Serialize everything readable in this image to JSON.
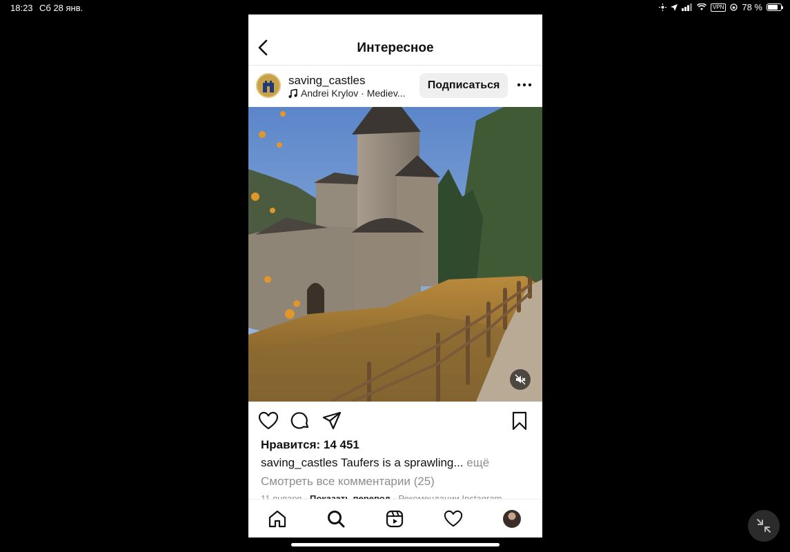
{
  "status_bar": {
    "time": "18:23",
    "date": "Сб 28 янв.",
    "vpn": "VPN",
    "battery": "78 %",
    "battery_level": 0.78
  },
  "header": {
    "title": "Интересное"
  },
  "post": {
    "username": "saving_castles",
    "audio": "Andrei Krylov · Mediev...",
    "follow_label": "Подписаться",
    "likes": "Нравится: 14 451",
    "caption_user": "saving_castles",
    "caption_text": " Taufers is a sprawling...",
    "caption_more": " ещё",
    "comments": "Смотреть все комментарии (25)",
    "date": "11 января",
    "separator": " · ",
    "translate": "Показать перевод",
    "recommendations": "Рекомендации Instagram"
  },
  "colors": {
    "accent_bg": "#efefef",
    "muted_text": "#8e8e8e",
    "background": "#000000"
  }
}
